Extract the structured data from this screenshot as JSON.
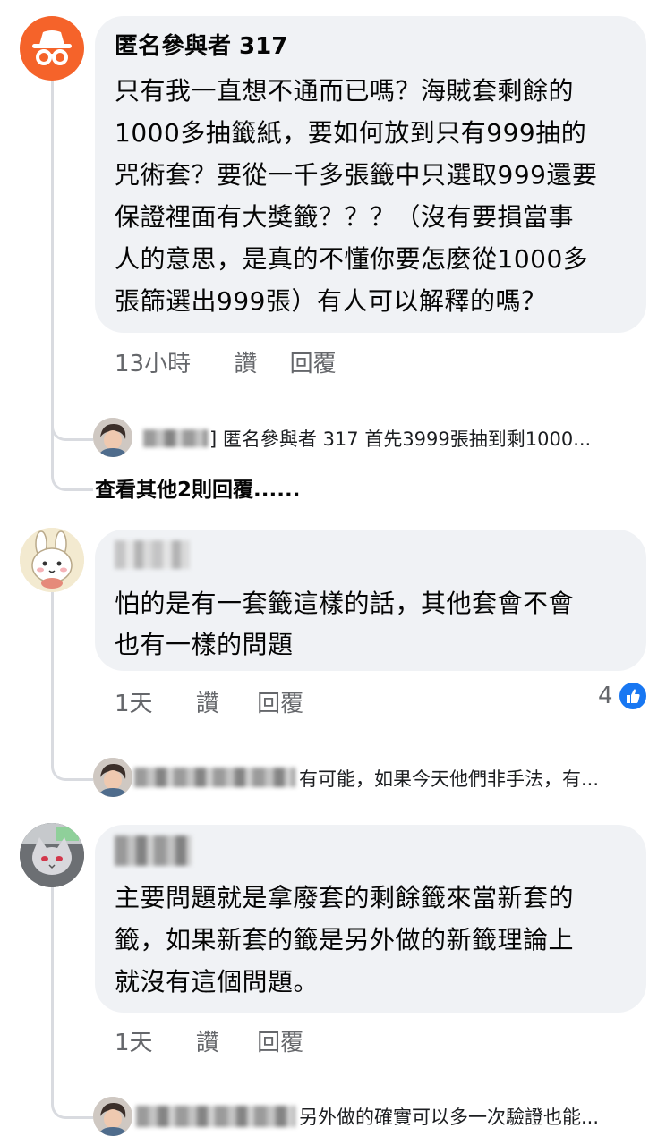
{
  "comments": [
    {
      "author": "匿名參與者 317",
      "avatar_icon": "anonymous-incognito-icon",
      "body_lines": [
        "只有我一直想不通而已嗎？海賊套剩餘的",
        "1000多抽籤紙，要如何放到只有999抽的",
        "咒術套？要從一千多張籤中只選取999還要",
        "保證裡面有大獎籤？？？（沒有要損當事",
        "人的意思，是真的不懂你要怎麼從1000多",
        "張篩選出999張）有人可以解釋的嗎？"
      ],
      "time": "13小時",
      "like_label": "讚",
      "reply_label": "回覆",
      "reply_preview": "匿名參與者 317 首先3999張抽到剩1000...",
      "more_replies": "查看其他2則回覆......"
    },
    {
      "author": "",
      "avatar_icon": "cartoon-rabbit-avatar",
      "body_lines": [
        "怕的是有一套籤這樣的話，其他套會不會",
        "也有一樣的問題"
      ],
      "time": "1天",
      "like_label": "讚",
      "reply_label": "回覆",
      "reactions_count": "4",
      "reaction_icon": "thumbs-up-icon",
      "reply_preview": "有可能，如果今天他們非手法，有..."
    },
    {
      "author": "",
      "avatar_icon": "cat-avatar",
      "body_lines": [
        "主要問題就是拿廢套的剩餘籤來當新套的",
        "籤，如果新套的籤是另外做的新籤理論上",
        "就沒有這個問題。"
      ],
      "time": "1天",
      "like_label": "讚",
      "reply_label": "回覆",
      "reply_preview": "另外做的確實可以多一次驗證也能..."
    }
  ],
  "colors": {
    "bubble": "#f0f2f5",
    "meta_text": "#65676b",
    "anon_avatar": "#f5632a",
    "like_blue": "#1877f2"
  }
}
